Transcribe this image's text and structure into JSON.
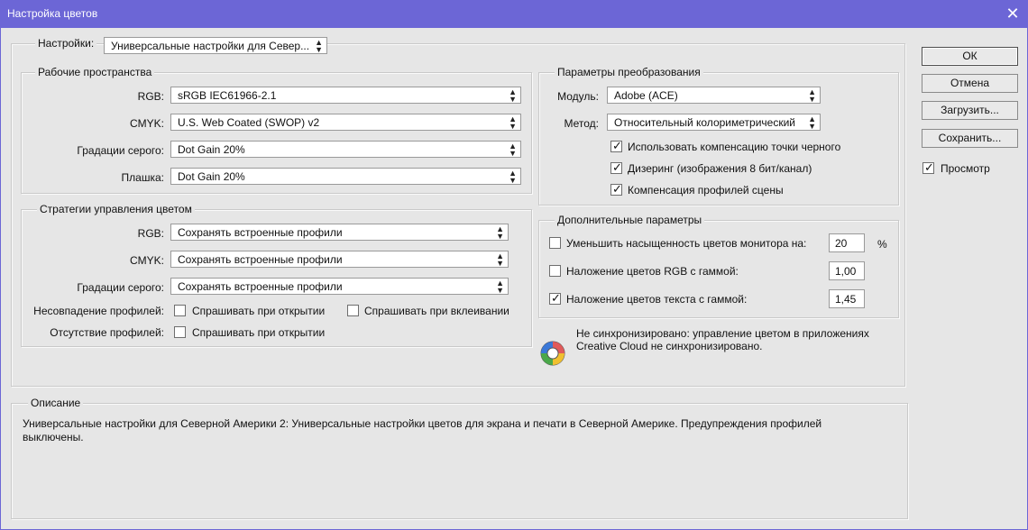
{
  "window": {
    "title": "Настройка цветов",
    "close_glyph": "✕"
  },
  "settings": {
    "label": "Настройки:",
    "value": "Универсальные настройки для Север..."
  },
  "working_spaces": {
    "legend": "Рабочие пространства",
    "rows": [
      {
        "label": "RGB:",
        "value": "sRGB IEC61966-2.1"
      },
      {
        "label": "CMYK:",
        "value": "U.S. Web Coated (SWOP) v2"
      },
      {
        "label": "Градации серого:",
        "value": "Dot Gain 20%"
      },
      {
        "label": "Плашка:",
        "value": "Dot Gain 20%"
      }
    ]
  },
  "policies": {
    "legend": "Стратегии управления цветом",
    "rows": [
      {
        "label": "RGB:",
        "value": "Сохранять встроенные профили"
      },
      {
        "label": "CMYK:",
        "value": "Сохранять встроенные профили"
      },
      {
        "label": "Градации серого:",
        "value": "Сохранять встроенные профили"
      }
    ],
    "mismatch_label": "Несовпадение профилей:",
    "mismatch_open": {
      "text": "Спрашивать при открытии",
      "checked": false
    },
    "mismatch_paste": {
      "text": "Спрашивать при вклеивании",
      "checked": false
    },
    "missing_label": "Отсутствие профилей:",
    "missing_open": {
      "text": "Спрашивать при открытии",
      "checked": false
    }
  },
  "conversion": {
    "legend": "Параметры преобразования",
    "engine_label": "Модуль:",
    "engine_value": "Adobe (ACE)",
    "intent_label": "Метод:",
    "intent_value": "Относительный колориметрический",
    "options": [
      {
        "text": "Использовать компенсацию точки черного",
        "checked": true
      },
      {
        "text": "Дизеринг (изображения 8 бит/канал)",
        "checked": true
      },
      {
        "text": "Компенсация профилей сцены",
        "checked": true
      }
    ]
  },
  "advanced": {
    "legend": "Дополнительные параметры",
    "desaturate": {
      "text": "Уменьшить насыщенность цветов монитора на:",
      "value": "20",
      "unit": "%",
      "checked": false
    },
    "rgb_gamma": {
      "text": "Наложение цветов RGB с гаммой:",
      "value": "1,00",
      "checked": false
    },
    "text_gamma": {
      "text": "Наложение цветов текста с гаммой:",
      "value": "1,45",
      "checked": true
    }
  },
  "sync": {
    "icon": "color-wheel-icon",
    "line1": "Не синхронизировано: управление цветом в приложениях",
    "line2": "Creative Cloud не синхронизировано."
  },
  "buttons": {
    "ok": "ОК",
    "cancel": "Отмена",
    "load": "Загрузить...",
    "save": "Сохранить..."
  },
  "preview": {
    "text": "Просмотр",
    "checked": true
  },
  "description": {
    "legend": "Описание",
    "line1": "Универсальные настройки для Северной Америки 2:  Универсальные настройки цветов для экрана и печати в Северной Америке. Предупреждения профилей",
    "line2": "выключены."
  },
  "colors": {
    "titlebar": "#6c66d6",
    "dialog_bg": "#e6e6e6"
  },
  "glyphs": {
    "check": "✓",
    "updown": "⬍"
  }
}
